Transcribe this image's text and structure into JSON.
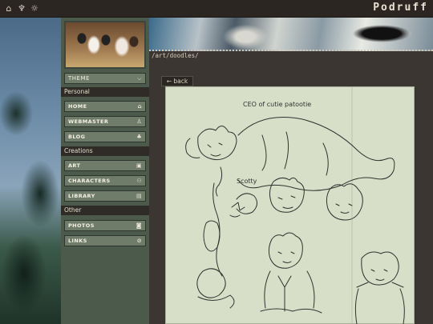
{
  "topbar": {
    "icons": [
      "home-icon",
      "tooth-icon",
      "sun-icon"
    ],
    "site_title": "Podruff"
  },
  "sidebar": {
    "theme_label": "THEME",
    "sections": {
      "personal": "Personal",
      "creations": "Creations",
      "other": "Other"
    },
    "items": [
      {
        "label": "HOME",
        "icon": "house-icon"
      },
      {
        "label": "WEBMASTER",
        "icon": "user-icon"
      },
      {
        "label": "BLOG",
        "icon": "leaf-icon"
      },
      {
        "label": "ART",
        "icon": "image-icon"
      },
      {
        "label": "CHARACTERS",
        "icon": "group-icon"
      },
      {
        "label": "LIBRARY",
        "icon": "book-icon"
      },
      {
        "label": "PHOTOS",
        "icon": "camera-icon"
      },
      {
        "label": "LINKS",
        "icon": "paperclip-icon"
      }
    ]
  },
  "breadcrumb": "/art/doodles/",
  "back_label": "← back",
  "drawing": {
    "caption_top": "CEO of cutie patootie",
    "caption_name": "Scotty"
  }
}
